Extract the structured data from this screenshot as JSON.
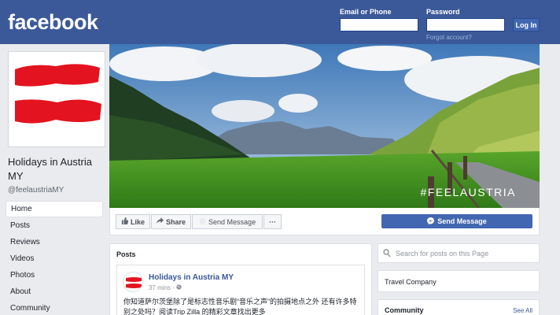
{
  "header": {
    "logo": "facebook",
    "email_label": "Email or Phone",
    "password_label": "Password",
    "login_button": "Log In",
    "forgot_link": "Forgot account?",
    "brand_color": "#3b5998"
  },
  "page": {
    "name": "Holidays in Austria MY",
    "handle": "@feelaustriaMY",
    "cover_hashtag": "#FEELAUSTRIA"
  },
  "nav": {
    "items": [
      {
        "label": "Home",
        "active": true
      },
      {
        "label": "Posts"
      },
      {
        "label": "Reviews"
      },
      {
        "label": "Videos"
      },
      {
        "label": "Photos"
      },
      {
        "label": "About"
      },
      {
        "label": "Community"
      }
    ]
  },
  "actions": {
    "like": "Like",
    "share": "Share",
    "send_message": "Send Message",
    "more": "···",
    "send_message_button": "Send Message"
  },
  "posts": {
    "title": "Posts",
    "items": [
      {
        "author": "Holidays in Austria MY",
        "time": "37 mins ·",
        "text": "你知道萨尔茨堡除了是标志性音乐剧“音乐之声”的拍摄地点之外 还有许多特别之处吗？阅读Trip Zilla 的精彩文章找出更多"
      }
    ]
  },
  "sidebar": {
    "search_placeholder": "Search for posts on this Page",
    "category": "Travel Company",
    "community_title": "Community",
    "see_all": "See All"
  },
  "icons": {
    "like": "thumbs-up-icon",
    "share": "share-arrow-icon",
    "messenger": "messenger-icon",
    "globe": "globe-icon",
    "search": "search-icon"
  }
}
